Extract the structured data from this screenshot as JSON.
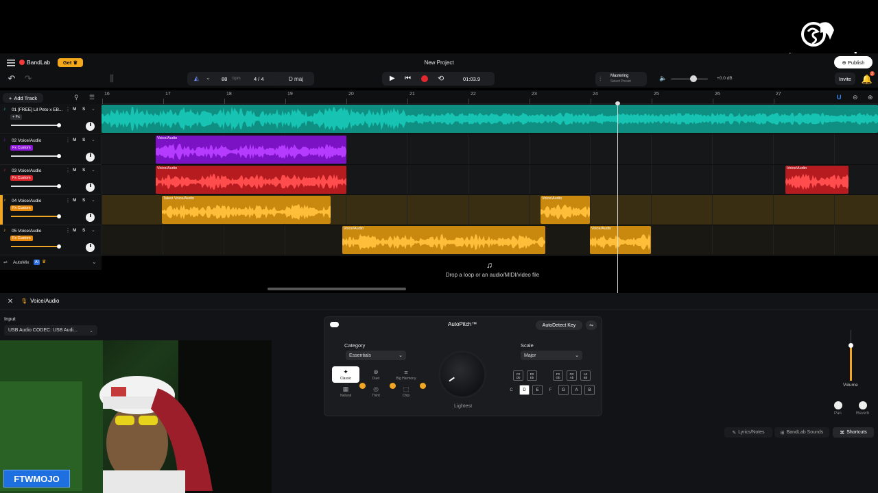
{
  "overlay": {
    "streamer_brand": "streamyard",
    "webcam_name": "FTWMOJO"
  },
  "app": {
    "brand": "BandLab",
    "get_label": "Get",
    "project_title": "New Project",
    "publish_label": "Publish",
    "invite_label": "Invite",
    "notification_count": "2"
  },
  "toolbar": {
    "bpm": "88",
    "bpm_unit": "bpm",
    "time_signature": "4 / 4",
    "key": "D maj",
    "time": "01:03.9",
    "mastering_label": "Mastering",
    "mastering_sub": "Select Preset",
    "master_volume": "+0.0 dB"
  },
  "tracks_panel": {
    "add_track": "Add Track",
    "automix_label": "AutoMix",
    "automix_badge": "AI"
  },
  "ruler": [
    "16",
    "17",
    "18",
    "19",
    "20",
    "21",
    "22",
    "23",
    "24",
    "25",
    "26",
    "27"
  ],
  "tracks": [
    {
      "num": "01",
      "name": "[FREE] Lil Peto x EB...",
      "fx": "+ Fx",
      "color": "#17c3b2",
      "fx_color": "#2a2c30"
    },
    {
      "num": "02",
      "name": "Voice/Audio",
      "fx": "Fx Custom",
      "color": "#8e18d9",
      "fx_color": "#8e18d9"
    },
    {
      "num": "03",
      "name": "Voice/Audio",
      "fx": "Fx Custom",
      "color": "#e0282e",
      "fx_color": "#e0282e"
    },
    {
      "num": "04",
      "name": "Voice/Audio",
      "fx": "Fx Custom",
      "color": "#f0a623",
      "fx_color": "#e98a0c"
    },
    {
      "num": "05",
      "name": "Voice/Audio",
      "fx": "Fx Custom",
      "color": "#f0a623",
      "fx_color": "#e98a0c"
    }
  ],
  "clips": {
    "voice": "Voice/Audio",
    "takes": "Takes"
  },
  "drop_hint": "Drop a loop or an audio/MIDI/video file",
  "editor": {
    "track_name": "Voice/Audio",
    "input_label": "Input",
    "input_value": "USB Audio CODEC: USB Audi...",
    "plugin_title": "AutoPitch™",
    "autodetect": "AutoDetect Key",
    "category_label": "Category",
    "category_value": "Essentials",
    "scale_label": "Scale",
    "scale_value": "Major",
    "knob_label": "Lightest",
    "presets": [
      "Classic",
      "Duet",
      "Big Harmony",
      "Natural",
      "Third",
      "Chip"
    ],
    "sharp_notes": [
      "C#\nDb",
      "D#\nEb",
      "F#\nGb",
      "G#\nAb",
      "A#\nBb"
    ],
    "natural_notes": [
      "C",
      "D",
      "E",
      "F",
      "G",
      "A",
      "B"
    ],
    "volume_label": "Volume",
    "pan_label": "Pan",
    "reverb_label": "Reverb"
  },
  "footer_tabs": [
    "Lyrics/Notes",
    "BandLab Sounds",
    "Shortcuts"
  ]
}
